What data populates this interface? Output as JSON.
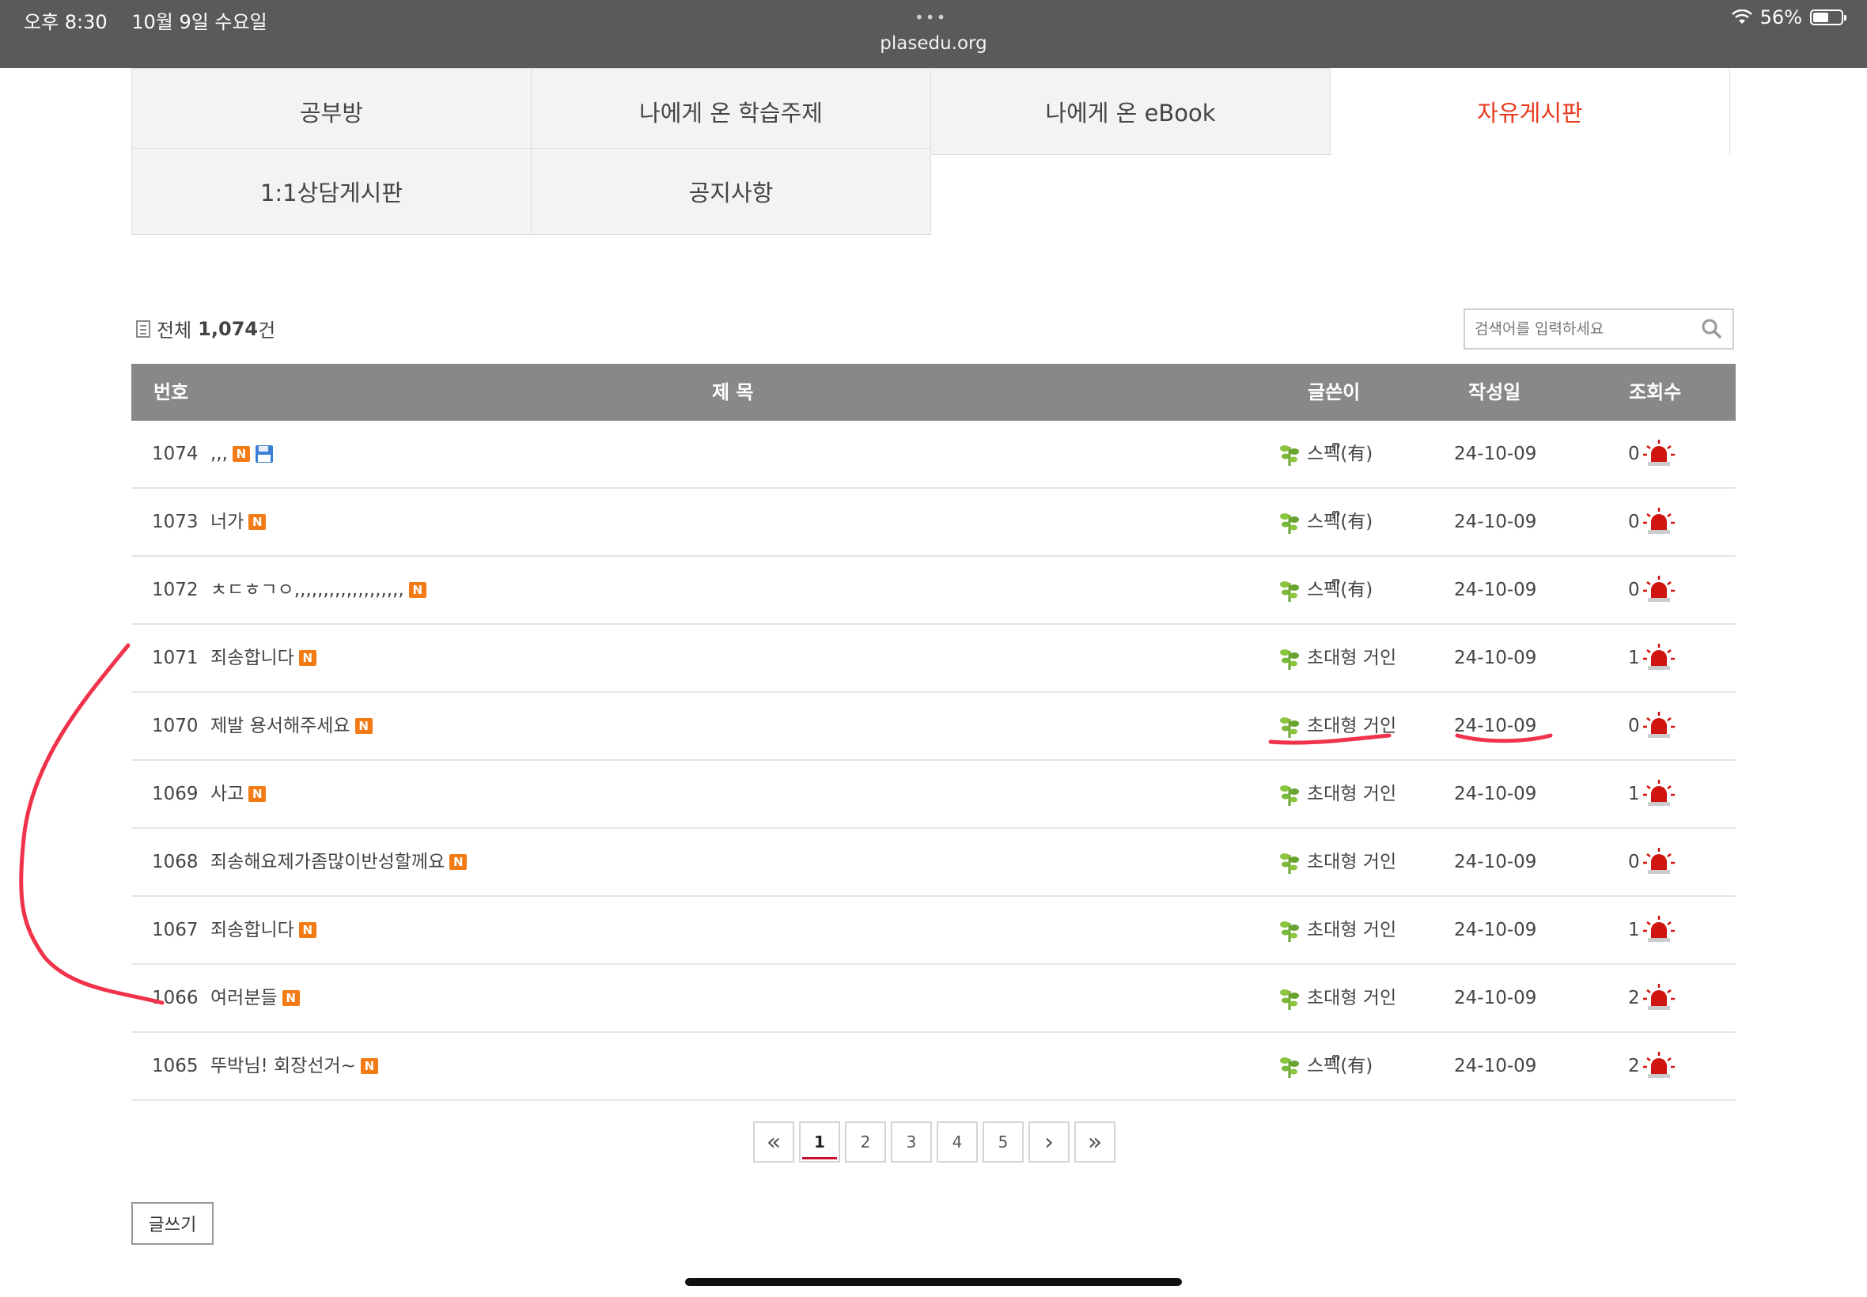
{
  "status_bar": {
    "time": "오후 8:30",
    "date": "10월 9일 수요일",
    "dots": "•••",
    "url": "plasedu.org",
    "battery_percent": "56%",
    "battery_level": 0.56
  },
  "tabs": [
    {
      "label": "공부방",
      "active": false
    },
    {
      "label": "나에게 온 학습주제",
      "active": false
    },
    {
      "label": "나에게 온 eBook",
      "active": false
    },
    {
      "label": "자유게시판",
      "active": true
    },
    {
      "label": "1:1상담게시판",
      "active": false
    },
    {
      "label": "공지사항",
      "active": false
    }
  ],
  "summary": {
    "prefix": "전체",
    "count": "1,074",
    "suffix": "건"
  },
  "search": {
    "placeholder": "검색어를 입력하세요"
  },
  "table": {
    "headers": {
      "num": "번호",
      "title": "제 목",
      "author": "글쓴이",
      "date": "작성일",
      "views": "조회수"
    },
    "rows": [
      {
        "num": "1074",
        "title": ",,,",
        "new": true,
        "attachment": true,
        "author": "스펙ᩚ(有)",
        "date": "24-10-09",
        "views": "0"
      },
      {
        "num": "1073",
        "title": "너가",
        "new": true,
        "attachment": false,
        "author": "스펙ᩚ(有)",
        "date": "24-10-09",
        "views": "0"
      },
      {
        "num": "1072",
        "title": "ㅊㄷㅎㄱㅇ,,,,,,,,,,,,,,,,,,,",
        "new": true,
        "attachment": false,
        "author": "스펙ᩚ(有)",
        "date": "24-10-09",
        "views": "0"
      },
      {
        "num": "1071",
        "title": "죄송합니다",
        "new": true,
        "attachment": false,
        "author": "초대형 거인",
        "date": "24-10-09",
        "views": "1"
      },
      {
        "num": "1070",
        "title": "제발 용서해주세요",
        "new": true,
        "attachment": false,
        "author": "초대형 거인",
        "date": "24-10-09",
        "views": "0"
      },
      {
        "num": "1069",
        "title": "사고",
        "new": true,
        "attachment": false,
        "author": "초대형 거인",
        "date": "24-10-09",
        "views": "1"
      },
      {
        "num": "1068",
        "title": "죄송해요제가좀많이반성할께요",
        "new": true,
        "attachment": false,
        "author": "초대형 거인",
        "date": "24-10-09",
        "views": "0"
      },
      {
        "num": "1067",
        "title": "죄송합니다",
        "new": true,
        "attachment": false,
        "author": "초대형 거인",
        "date": "24-10-09",
        "views": "1"
      },
      {
        "num": "1066",
        "title": "여러분들",
        "new": true,
        "attachment": false,
        "author": "초대형 거인",
        "date": "24-10-09",
        "views": "2"
      },
      {
        "num": "1065",
        "title": "뚜박님! 회장선거~",
        "new": true,
        "attachment": false,
        "author": "스펙ᩚ(有)",
        "date": "24-10-09",
        "views": "2"
      }
    ],
    "new_badge": "N"
  },
  "pagination": {
    "first": "«",
    "pages": [
      "1",
      "2",
      "3",
      "4",
      "5"
    ],
    "current": "1",
    "next": "›",
    "last": "»"
  },
  "write_button": "글쓰기",
  "colors": {
    "accent": "#e8391d",
    "header_bg": "#888888",
    "badge": "#f27b15",
    "annotation": "#f0324b",
    "siren": "#d0140f",
    "tree": "#6aa230"
  }
}
